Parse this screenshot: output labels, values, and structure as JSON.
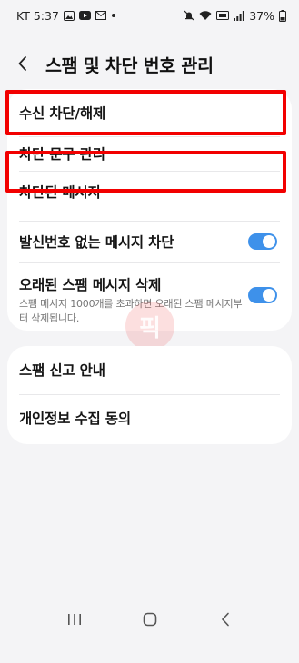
{
  "status_bar": {
    "carrier_time": "KT 5:37",
    "battery": "37%",
    "left_icons": [
      "gallery-icon",
      "youtube-icon",
      "mail-icon",
      "dot-icon"
    ],
    "right_icons": [
      "alarm-off-icon",
      "wifi-icon",
      "lte-icon",
      "signal-icon",
      "battery-icon"
    ]
  },
  "header": {
    "title": "스팸 및 차단 번호 관리"
  },
  "settings": {
    "block_numbers": {
      "label": "수신 차단/해제"
    },
    "block_phrases": {
      "label": "차단 문구 관리"
    },
    "blocked_messages": {
      "label": "차단된 메시지"
    },
    "block_unknown": {
      "label": "발신번호 없는 메시지 차단",
      "enabled": true
    },
    "delete_old_spam": {
      "label": "오래된 스팸 메시지 삭제",
      "description": "스팸 메시지 1000개를 초과하면 오래된 스팸 메시지부터 삭제됩니다.",
      "enabled": true
    },
    "spam_report_info": {
      "label": "스팸 신고 안내"
    },
    "privacy_consent": {
      "label": "개인정보 수집 동의"
    }
  },
  "watermark_text": "픽",
  "colors": {
    "toggle_on": "#3e91ea",
    "highlight": "#f20000",
    "background": "#f4f4f6"
  }
}
